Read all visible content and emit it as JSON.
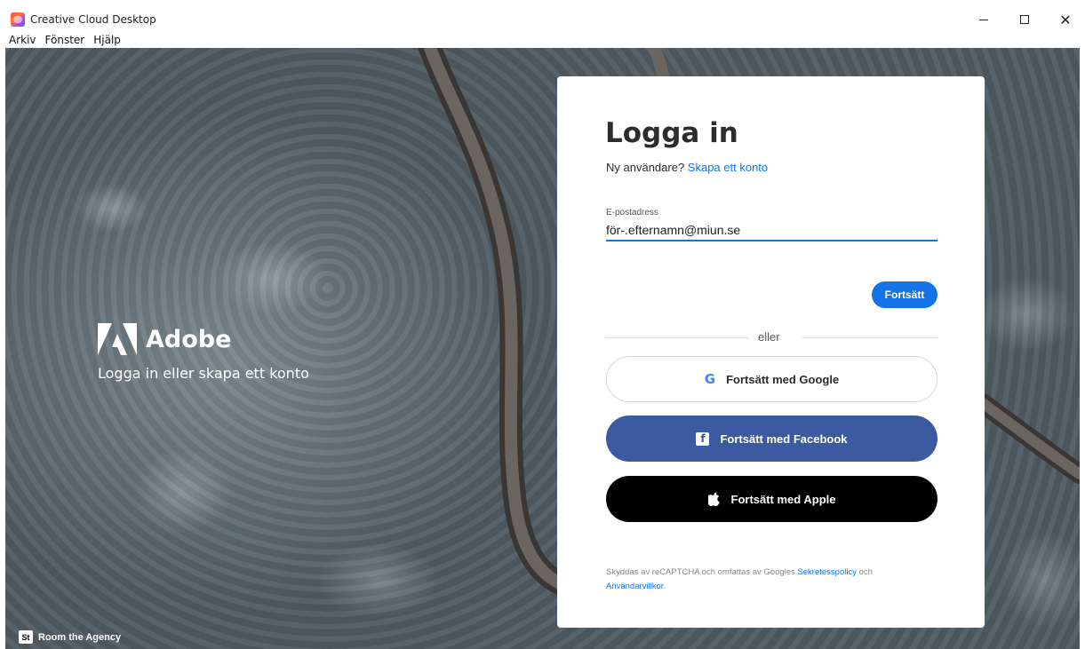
{
  "window": {
    "title": "Creative Cloud Desktop",
    "minimize_icon": "minimize-icon",
    "maximize_icon": "maximize-icon",
    "close_glyph": "✕"
  },
  "menu": [
    "Arkiv",
    "Fönster",
    "Hjälp"
  ],
  "brand": {
    "name": "Adobe",
    "tagline": "Logga in eller skapa ett konto",
    "credit_badge": "St",
    "credit": "Room the Agency"
  },
  "login": {
    "title": "Logga in",
    "new_user_prompt": "Ny användare?",
    "create_account_link": "Skapa ett konto",
    "email_label": "E-postadress",
    "email_value": "för-.efternamn@miun.se",
    "continue_label": "Fortsätt",
    "or_text": "eller",
    "google_label": "Fortsätt med Google",
    "google_glyph": "G",
    "facebook_label": "Fortsätt med Facebook",
    "facebook_glyph": "f",
    "apple_label": "Fortsätt med Apple",
    "legal_prefix": "Skyddas av reCAPTCHA och omfattas av Googles",
    "privacy_link": "Sekretesspolicy",
    "legal_and": "och",
    "terms_link": "Användarvillkor",
    "legal_suffix": "."
  },
  "colors": {
    "accent": "#1473e6",
    "facebook": "#3b5aa0",
    "apple": "#000000"
  }
}
